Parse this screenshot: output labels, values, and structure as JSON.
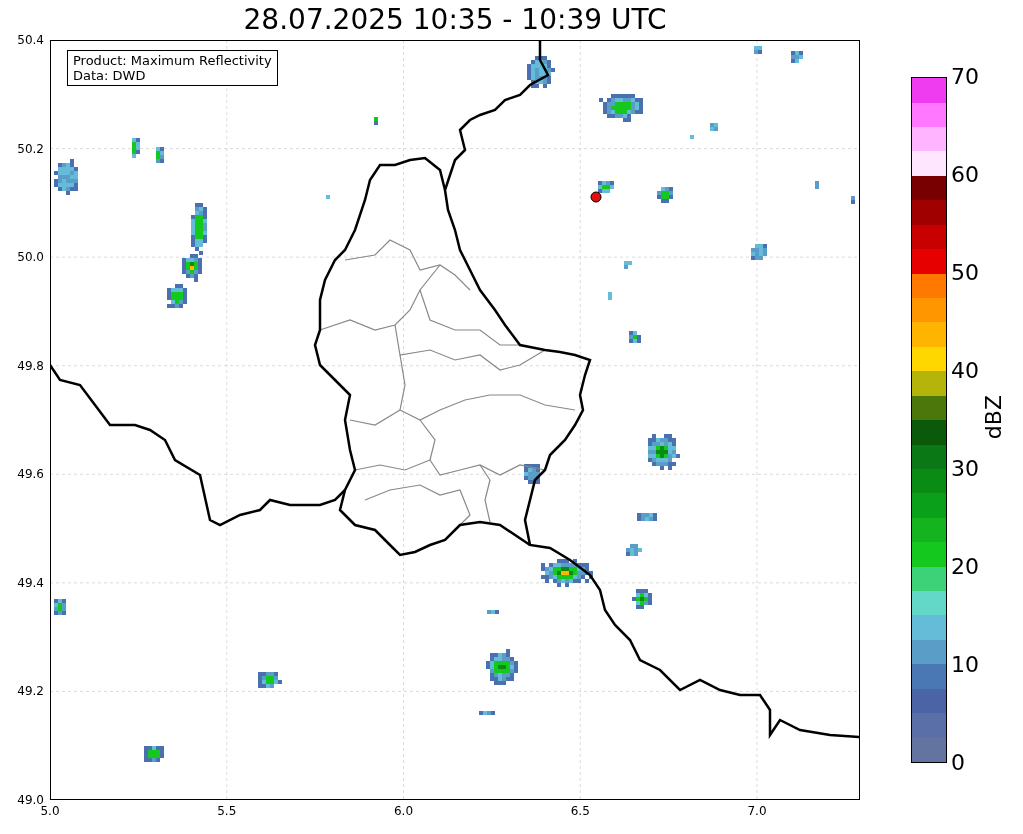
{
  "title": "28.07.2025 10:35 - 10:39 UTC",
  "legend": [
    "Product: Maximum Reflectivity",
    "Data: DWD"
  ],
  "y_ticks": [
    "50.4",
    "50.2",
    "50.0",
    "49.8",
    "49.6",
    "49.4",
    "49.2",
    "49.0"
  ],
  "x_ticks": [
    "5.0",
    "5.5",
    "6.0",
    "6.5",
    "7.0"
  ],
  "colorbar": {
    "label": "dBZ",
    "ticks": [
      "70",
      "60",
      "50",
      "40",
      "30",
      "20",
      "10",
      "0"
    ],
    "bands": [
      {
        "color": "#6474a0"
      },
      {
        "color": "#5a6ea8"
      },
      {
        "color": "#4a64a6"
      },
      {
        "color": "#4a78b4"
      },
      {
        "color": "#5a9ec8"
      },
      {
        "color": "#64bcd8"
      },
      {
        "color": "#64d8c8"
      },
      {
        "color": "#3cd278"
      },
      {
        "color": "#14c81e"
      },
      {
        "color": "#14b41e"
      },
      {
        "color": "#0aa01a"
      },
      {
        "color": "#0a8c14"
      },
      {
        "color": "#0a7814"
      },
      {
        "color": "#0a5a0a"
      },
      {
        "color": "#4a780a"
      },
      {
        "color": "#b4b40a"
      },
      {
        "color": "#ffd700"
      },
      {
        "color": "#ffb400"
      },
      {
        "color": "#ff9600"
      },
      {
        "color": "#ff7800"
      },
      {
        "color": "#e60000"
      },
      {
        "color": "#c80000"
      },
      {
        "color": "#a00000"
      },
      {
        "color": "#780000"
      },
      {
        "color": "#ffe6ff"
      },
      {
        "color": "#ffb4ff"
      },
      {
        "color": "#ff78ff"
      },
      {
        "color": "#f03cf0"
      }
    ]
  }
}
